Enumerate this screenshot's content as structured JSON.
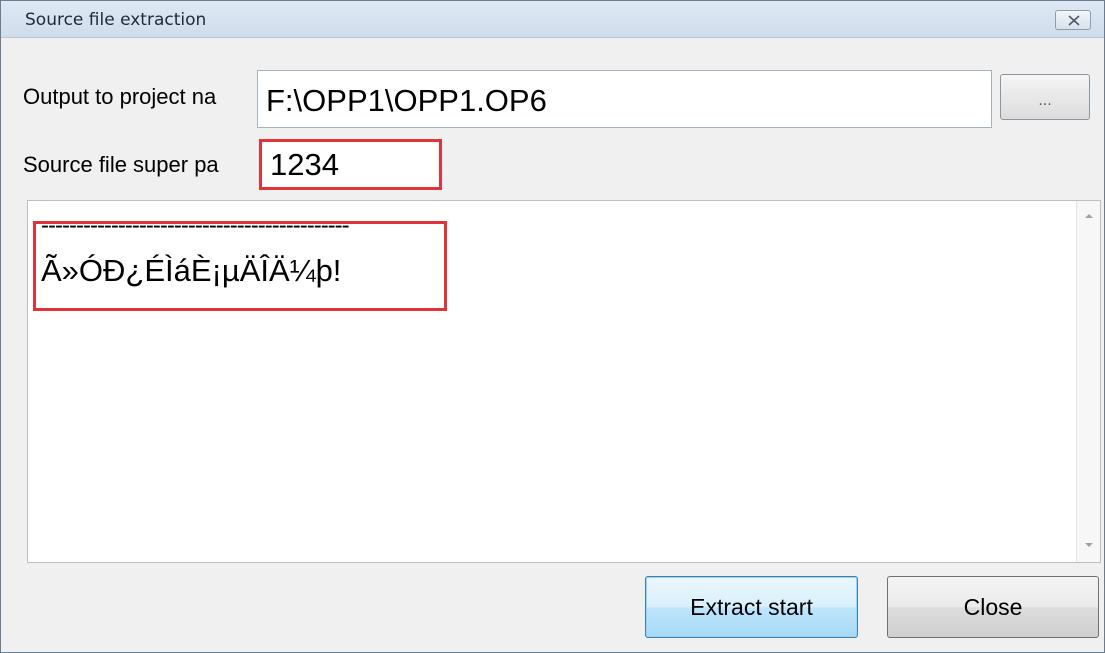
{
  "window": {
    "title": "Source file extraction",
    "close_icon": "close-icon"
  },
  "form": {
    "output_label": "Output to project na",
    "output_value": "F:\\OPP1\\OPP1.OP6",
    "browse_label": "...",
    "super_label": "Source file super pa",
    "super_value": "1234"
  },
  "log": {
    "dash_line": "--------------------------------------------",
    "garbled_line": "Ã»ÓÐ¿ÉÌáÈ¡µÄÎÄ¼þ!"
  },
  "buttons": {
    "extract_label": "Extract start",
    "close_label": "Close"
  },
  "colors": {
    "highlight": "#e0343a",
    "accent": "#3c7fb1"
  }
}
